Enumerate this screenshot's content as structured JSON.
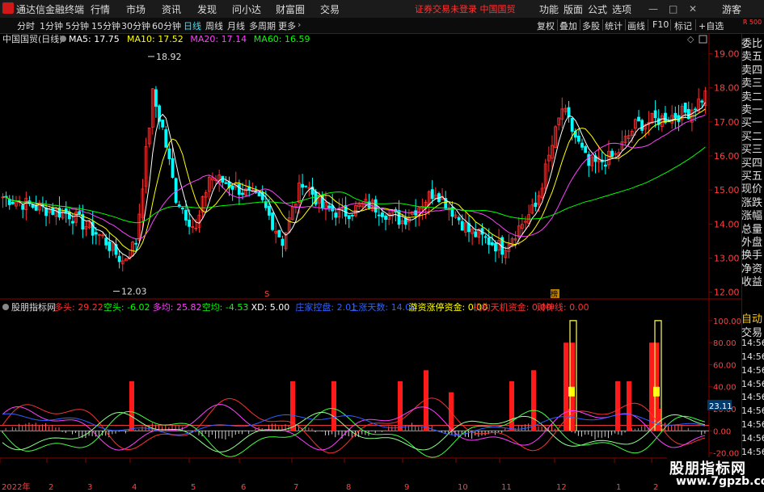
{
  "window": {
    "title": "通达信金融终端",
    "menus": [
      "行情",
      "市场",
      "资讯",
      "发现",
      "问小达",
      "财富圈",
      "交易"
    ],
    "notice": "证券交易未登录  中国国贸",
    "top_right": [
      "功能",
      "版面",
      "公式",
      "选项"
    ],
    "guest": "游客"
  },
  "toolbar": {
    "periods": [
      "分时",
      "1分钟",
      "5分钟",
      "15分钟",
      "30分钟",
      "60分钟",
      "日线",
      "周线",
      "月线",
      "多周期",
      "更多"
    ],
    "active_period": "日线",
    "right_buttons": [
      "复权",
      "叠加",
      "多股",
      "统计",
      "画线",
      "F10",
      "标记",
      "+自选"
    ],
    "back_label": "R 500"
  },
  "main_chart": {
    "name": "中国国贸(日线)",
    "ma": [
      {
        "label": "MA5: 17.75",
        "color": "#ffffff"
      },
      {
        "label": "MA10: 17.52",
        "color": "#ffff00"
      },
      {
        "label": "MA20: 17.14",
        "color": "#ff40ff"
      },
      {
        "label": "MA60: 16.59",
        "color": "#00ff00"
      }
    ],
    "y_ticks": [
      "19.00",
      "18.00",
      "17.00",
      "16.00",
      "15.00",
      "14.00",
      "13.00",
      "12.00"
    ],
    "y_values": [
      19,
      18,
      17,
      16,
      15,
      14,
      13,
      12
    ],
    "high_label": "18.92",
    "low_label": "12.03",
    "markers": [
      "S",
      "榜"
    ]
  },
  "indicator": {
    "name": "股朋指标网",
    "items": [
      {
        "label": "多头: 29.22",
        "color": "#ff3030"
      },
      {
        "label": "空头: -6.02",
        "color": "#00ff00"
      },
      {
        "label": "多均: 25.82",
        "color": "#ff40ff"
      },
      {
        "label": "空均: -4.53",
        "color": "#00ff00"
      },
      {
        "label": "XD: 5.00",
        "color": "#ffffff"
      },
      {
        "label": "庄家控盘: 2.01",
        "color": "#3060ff"
      },
      {
        "label": "上涨天数: 14.00",
        "color": "#3060ff"
      },
      {
        "label": "游资涨停资金: 0.00",
        "color": "#ffff00"
      },
      {
        "label": "机构天机资金: 0.00",
        "color": "#ff3030"
      },
      {
        "label": "财神线: 0.00",
        "color": "#ff3030"
      }
    ],
    "y_ticks": [
      "100.00",
      "80.00",
      "60.00",
      "40.00",
      "20.00",
      "0.00",
      "-20.00"
    ],
    "y_values": [
      100,
      80,
      60,
      40,
      20,
      0,
      -20
    ],
    "current_value": "23.11"
  },
  "x_axis": [
    "2022年",
    "2",
    "3",
    "4",
    "5",
    "6",
    "7",
    "8",
    "9",
    "10",
    "11",
    "12",
    "1",
    "2"
  ],
  "right_panel": {
    "top_items": [
      "委比",
      "卖五",
      "卖四",
      "卖三",
      "卖二",
      "卖一",
      "买一",
      "买二",
      "买三",
      "买四",
      "买五",
      "现价",
      "涨跌",
      "涨幅",
      "总量",
      "外盘",
      "换手",
      "净资",
      "收益"
    ],
    "bottom_items": [
      "自动",
      "交易",
      "14:56",
      "14:56",
      "14:56",
      "14:56",
      "14:56",
      "14:56",
      "14:56",
      "14:56",
      "14:56"
    ]
  },
  "watermark": {
    "line1": "股朋指标网",
    "line2": "www.7gpzb.com"
  },
  "colors": {
    "up": "#ff3030",
    "down": "#00ffff",
    "ma5": "#ffffff",
    "ma10": "#ffff00",
    "ma20": "#ff40ff",
    "ma60": "#00ff00",
    "grid": "#8a0000"
  }
}
